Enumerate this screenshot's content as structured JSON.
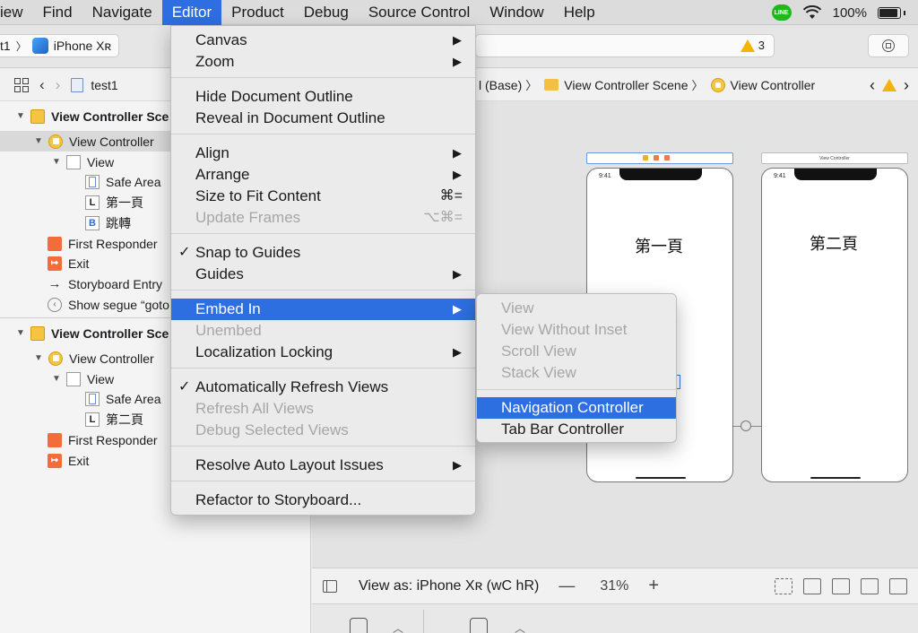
{
  "menubar": {
    "items": [
      "iew",
      "Find",
      "Navigate",
      "Editor",
      "Product",
      "Debug",
      "Source Control",
      "Window",
      "Help"
    ],
    "line_label": "LINE",
    "battery": "100%"
  },
  "toolbar": {
    "scheme_project": "t1",
    "scheme_device": "iPhone Xʀ",
    "warning_count": "3"
  },
  "navigator": {
    "breadcrumb_project": "test1",
    "scene1": {
      "title": "View Controller Sce",
      "controller": "View Controller",
      "view": "View",
      "safe_area": "Safe Area",
      "label": "第一頁",
      "button": "跳轉",
      "first_responder": "First Responder",
      "exit": "Exit",
      "entry": "Storyboard Entry",
      "segue": "Show segue “goto"
    },
    "scene2": {
      "title": "View Controller Sce",
      "controller": "View Controller",
      "view": "View",
      "safe_area": "Safe Area",
      "label": "第二頁",
      "first_responder": "First Responder",
      "exit": "Exit"
    }
  },
  "jumpbar": {
    "base": "l (Base)",
    "scene": "View Controller Scene",
    "controller": "View Controller"
  },
  "canvas": {
    "phone1_time": "9:41",
    "phone1_title": "第一頁",
    "phone2_header": "View Controller",
    "phone2_time": "9:41",
    "phone2_title": "第二頁"
  },
  "bottombar": {
    "view_as": "View as: iPhone Xʀ (wC hR)",
    "zoom_out": "—",
    "zoom": "31%",
    "zoom_in": "+"
  },
  "editor_menu": {
    "canvas": "Canvas",
    "zoom": "Zoom",
    "hide_outline": "Hide Document Outline",
    "reveal_outline": "Reveal in Document Outline",
    "align": "Align",
    "arrange": "Arrange",
    "size_to_fit": "Size to Fit Content",
    "size_to_fit_shortcut": "⌘=",
    "update_frames": "Update Frames",
    "update_frames_shortcut": "⌥⌘=",
    "snap_to_guides": "Snap to Guides",
    "guides": "Guides",
    "embed_in": "Embed In",
    "unembed": "Unembed",
    "localization_locking": "Localization Locking",
    "auto_refresh": "Automatically Refresh Views",
    "refresh_all": "Refresh All Views",
    "debug_selected": "Debug Selected Views",
    "resolve_auto_layout": "Resolve Auto Layout Issues",
    "refactor": "Refactor to Storyboard...",
    "checkmark": "✓",
    "submenu_arrow": "▶"
  },
  "embed_menu": {
    "view": "View",
    "view_without_inset": "View Without Inset",
    "scroll_view": "Scroll View",
    "stack_view": "Stack View",
    "navigation_controller": "Navigation Controller",
    "tab_bar_controller": "Tab Bar Controller"
  }
}
